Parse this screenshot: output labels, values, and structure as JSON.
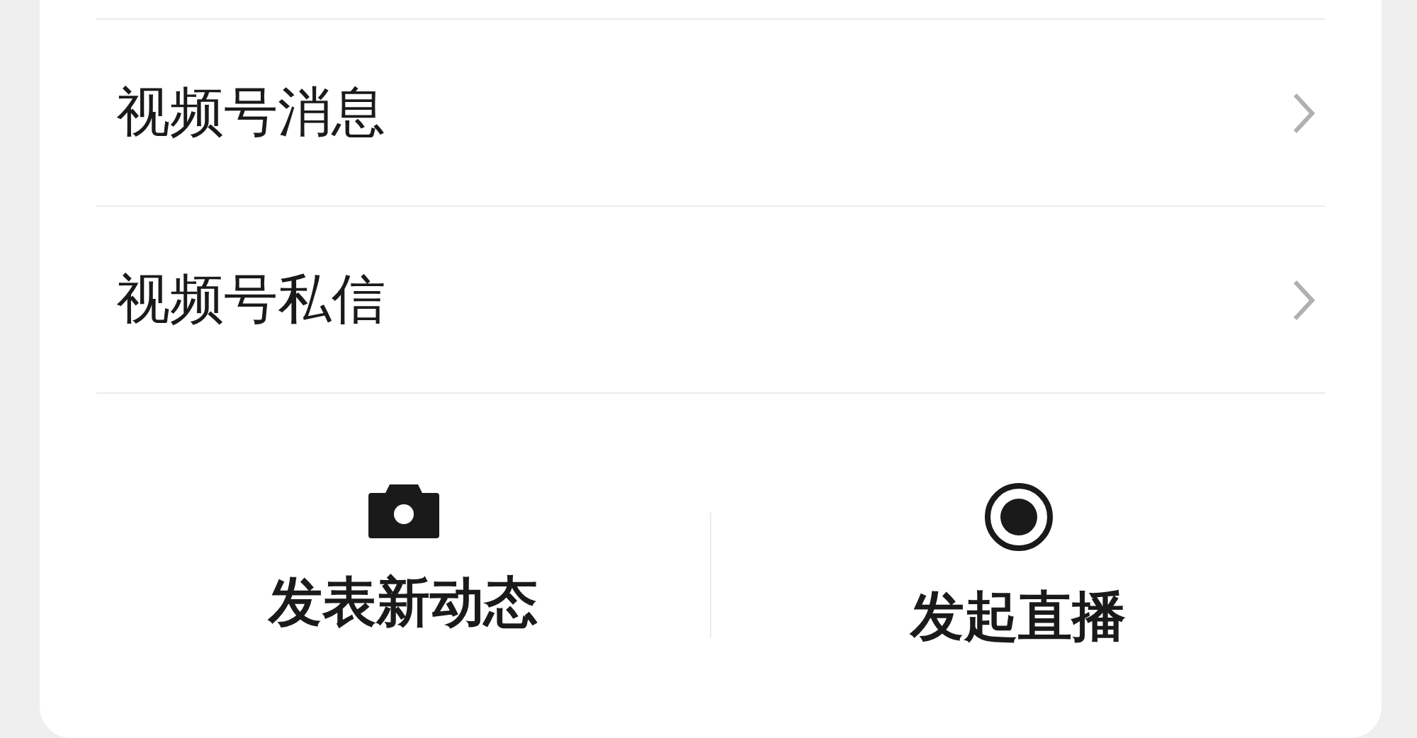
{
  "menu_items": [
    {
      "label": "视频号消息"
    },
    {
      "label": "视频号私信"
    }
  ],
  "actions": [
    {
      "kind": "camera",
      "label": "发表新动态"
    },
    {
      "kind": "live",
      "label": "发起直播"
    }
  ]
}
